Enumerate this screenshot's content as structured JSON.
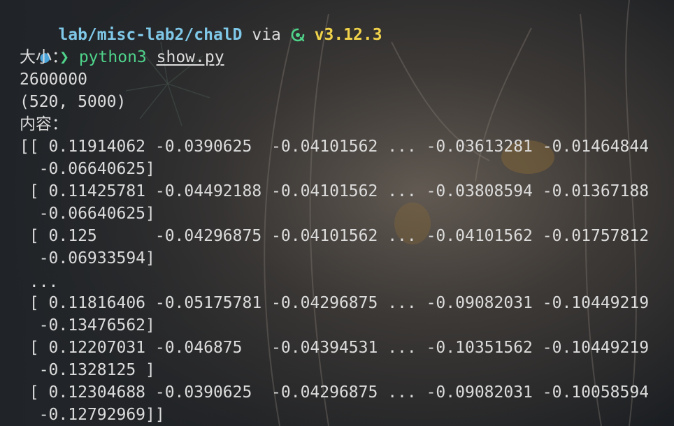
{
  "prompt": {
    "path": "lab/misc-lab2/chalD",
    "via": "via",
    "python_icon": "python-icon",
    "version": "v3.12.3",
    "status_dot": "●",
    "chevron": "❯",
    "command": "python3",
    "argument": "show.py"
  },
  "output": [
    "大小：",
    "2600000",
    "(520, 5000)",
    "内容：",
    "[[ 0.11914062 -0.0390625  -0.04101562 ... -0.03613281 -0.01464844",
    "  -0.06640625]",
    " [ 0.11425781 -0.04492188 -0.04101562 ... -0.03808594 -0.01367188",
    "  -0.06640625]",
    " [ 0.125      -0.04296875 -0.04101562 ... -0.04101562 -0.01757812",
    "  -0.06933594]",
    " ...",
    " [ 0.11816406 -0.05175781 -0.04296875 ... -0.09082031 -0.10449219",
    "  -0.13476562]",
    " [ 0.12207031 -0.046875   -0.04394531 ... -0.10351562 -0.10449219",
    "  -0.1328125 ]",
    " [ 0.12304688 -0.0390625  -0.04296875 ... -0.09082031 -0.10058594",
    "  -0.12792969]]"
  ],
  "colors": {
    "path": "#7fc8e8",
    "version": "#f0d24a",
    "command": "#4fd38a",
    "text": "#dcdcdc",
    "status_dot": "#4aa3d9"
  }
}
